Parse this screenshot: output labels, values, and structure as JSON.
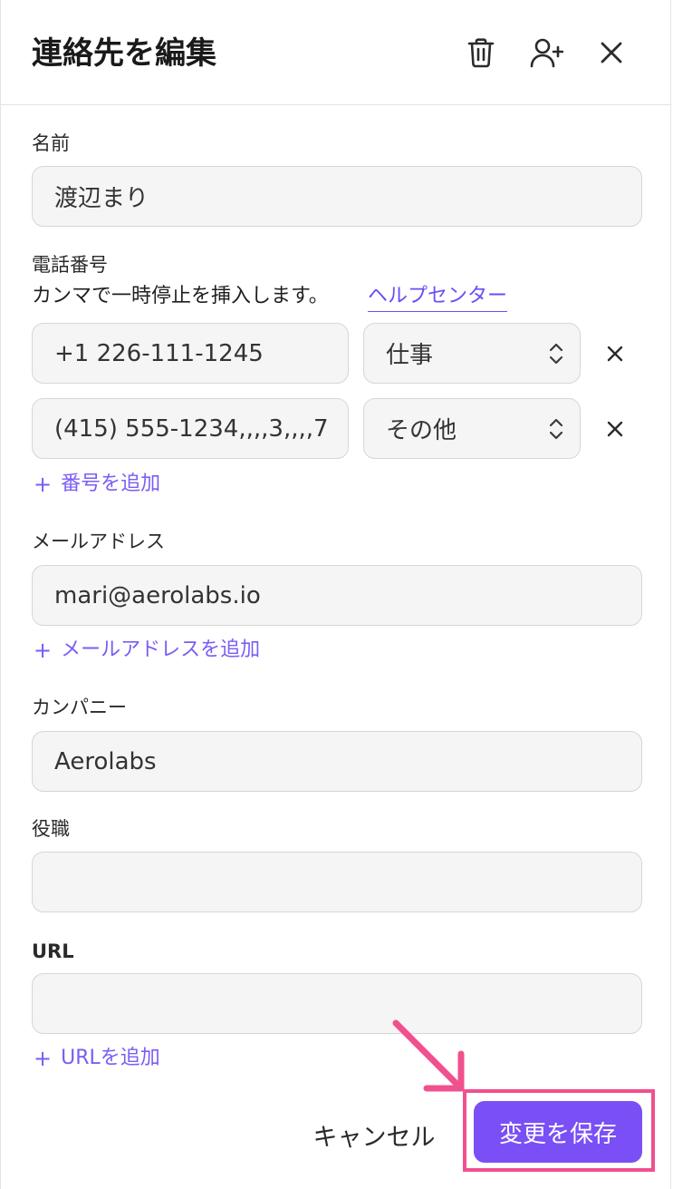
{
  "header": {
    "title": "連絡先を編集"
  },
  "name": {
    "label": "名前",
    "value": "渡辺まり"
  },
  "phone": {
    "label": "電話番号",
    "hint": "カンマで一時停止を挿入します。",
    "help_link": "ヘルプセンター",
    "entries": [
      {
        "value": "+1 226-111-1245",
        "type": "仕事"
      },
      {
        "value": "(415) 555-1234,,,,3,,,,7",
        "type": "その他"
      }
    ],
    "add_label": "番号を追加"
  },
  "email": {
    "label": "メールアドレス",
    "value": "mari@aerolabs.io",
    "add_label": "メールアドレスを追加"
  },
  "company": {
    "label": "カンパニー",
    "value": "Aerolabs"
  },
  "job_title": {
    "label": "役職",
    "value": ""
  },
  "url": {
    "label": "URL",
    "value": "",
    "add_label": "URLを追加"
  },
  "footer": {
    "cancel_label": "キャンセル",
    "save_label": "変更を保存"
  },
  "add_prefix": "+",
  "icons": {
    "delete": "trash-icon",
    "add_person": "add-person-icon",
    "close": "close-icon",
    "remove": "close-icon",
    "select": "chevron-up-down-icon"
  },
  "colors": {
    "accent": "#7a4ff6",
    "link": "#6b4ef6",
    "highlight": "#f1508f"
  }
}
